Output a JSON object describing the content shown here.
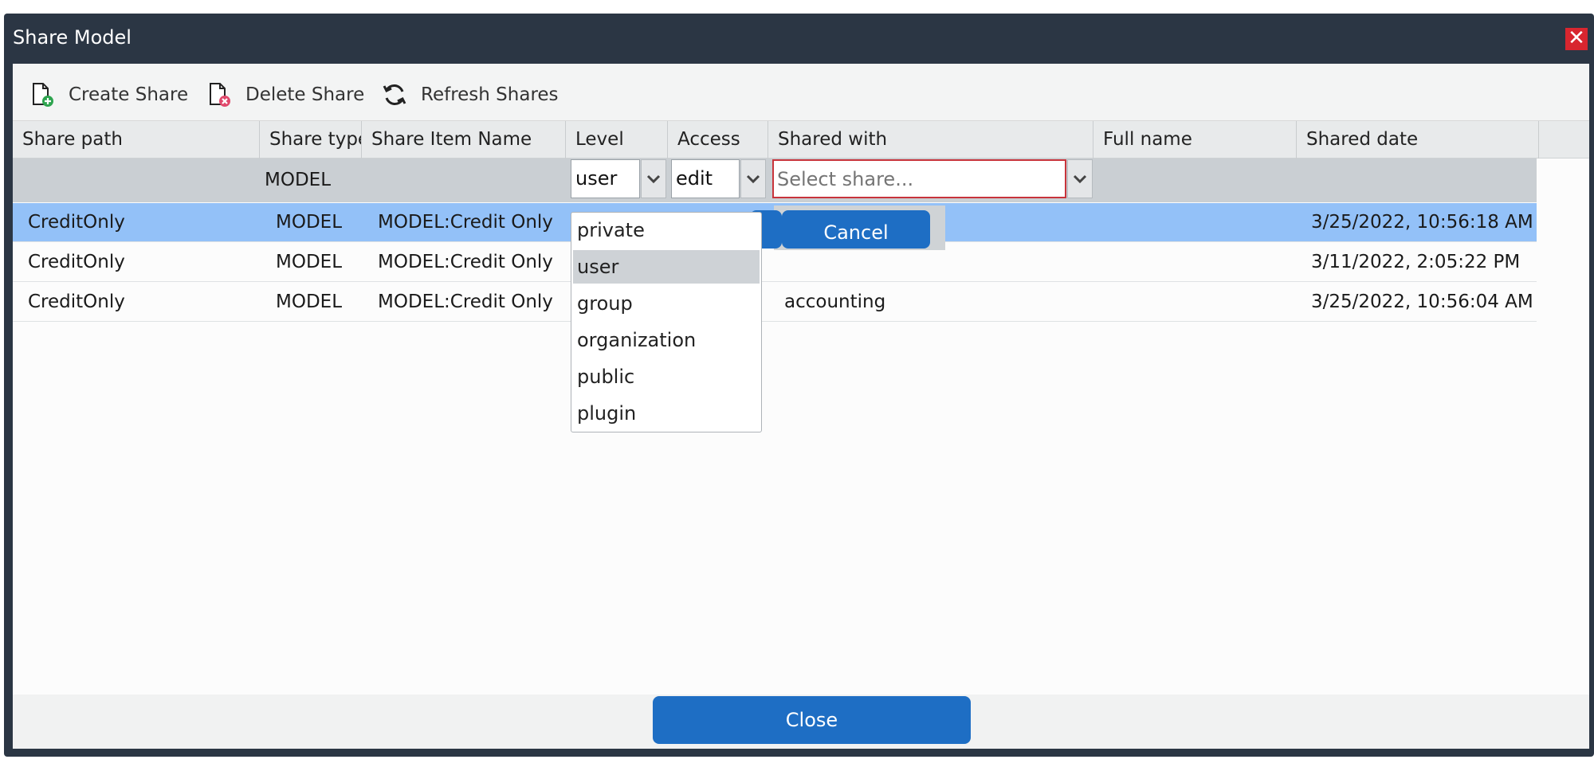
{
  "dialog": {
    "title": "Share Model",
    "close_glyph": "✕",
    "close_button_label": "Close"
  },
  "toolbar": {
    "create_label": "Create Share",
    "delete_label": "Delete Share",
    "refresh_label": "Refresh Shares",
    "create_icon": "file-add-icon",
    "delete_icon": "file-delete-icon",
    "refresh_icon": "refresh-icon"
  },
  "columns": [
    "Share path",
    "Share type",
    "Share Item Name",
    "Level",
    "Access",
    "Shared with",
    "Full name",
    "Shared date"
  ],
  "edit_row": {
    "share_type": "MODEL",
    "level_value": "user",
    "access_value": "edit",
    "shared_with_placeholder": "Select share...",
    "cancel_label": "Cancel"
  },
  "level_dropdown": {
    "options": [
      "private",
      "user",
      "group",
      "organization",
      "public",
      "plugin"
    ],
    "highlighted": "user"
  },
  "rows": [
    {
      "share_path": "CreditOnly",
      "share_type": "MODEL",
      "item_name": "MODEL:Credit Only",
      "level": "",
      "access": "",
      "shared_with": "",
      "full_name": "",
      "shared_date": "3/25/2022, 10:56:18 AM"
    },
    {
      "share_path": "CreditOnly",
      "share_type": "MODEL",
      "item_name": "MODEL:Credit Only",
      "level": "",
      "access": "",
      "shared_with": "",
      "full_name": "",
      "shared_date": "3/11/2022, 2:05:22 PM"
    },
    {
      "share_path": "CreditOnly",
      "share_type": "MODEL",
      "item_name": "MODEL:Credit Only",
      "level": "",
      "access": "",
      "shared_with": "accounting",
      "full_name": "",
      "shared_date": "3/25/2022, 10:56:04 AM"
    }
  ],
  "colors": {
    "frame": "#2b3644",
    "accent_blue": "#1e6ec4",
    "selected_row": "#93c1f8",
    "close_red": "#d8262f",
    "invalid_border": "#c8343b"
  }
}
